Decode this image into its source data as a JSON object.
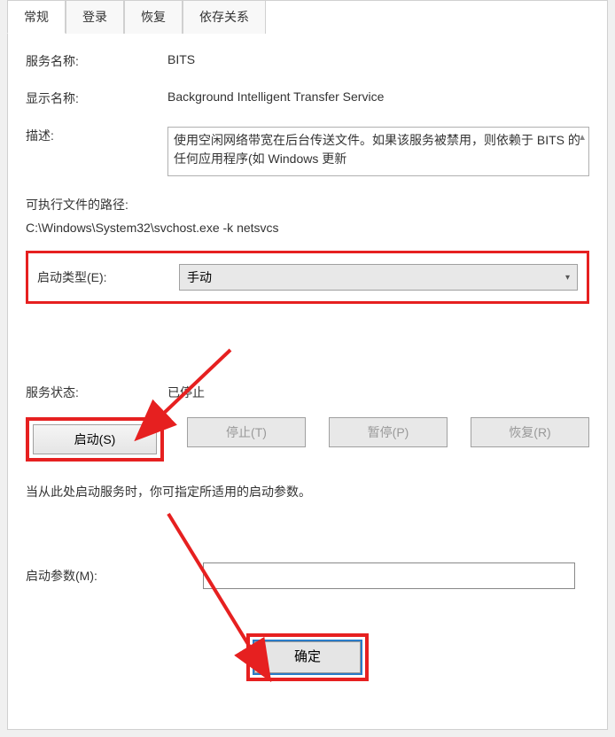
{
  "tabs": {
    "general": "常规",
    "logon": "登录",
    "recovery": "恢复",
    "dependencies": "依存关系"
  },
  "labels": {
    "service_name": "服务名称:",
    "display_name": "显示名称:",
    "description": "描述:",
    "exe_path": "可执行文件的路径:",
    "startup_type": "启动类型(E):",
    "service_status": "服务状态:",
    "startup_params": "启动参数(M):"
  },
  "values": {
    "service_name": "BITS",
    "display_name": "Background Intelligent Transfer Service",
    "description": "使用空闲网络带宽在后台传送文件。如果该服务被禁用，则依赖于 BITS 的任何应用程序(如 Windows 更新",
    "exe_path": "C:\\Windows\\System32\\svchost.exe -k netsvcs",
    "startup_type": "手动",
    "service_status": "已停止"
  },
  "buttons": {
    "start": "启动(S)",
    "stop": "停止(T)",
    "pause": "暂停(P)",
    "resume": "恢复(R)",
    "ok": "确定"
  },
  "hint": "当从此处启动服务时，你可指定所适用的启动参数。"
}
